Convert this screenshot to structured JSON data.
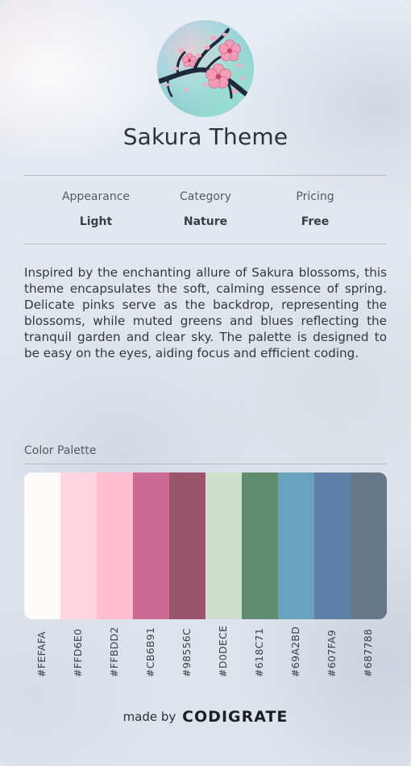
{
  "theme": {
    "title": "Sakura Theme",
    "logo_icon": "cherry-blossom-branch-icon"
  },
  "meta": [
    {
      "label": "Appearance",
      "value": "Light"
    },
    {
      "label": "Category",
      "value": "Nature"
    },
    {
      "label": "Pricing",
      "value": "Free"
    }
  ],
  "description": "Inspired by the enchanting allure of Sakura blossoms, this theme encapsulates the soft, calming essence of spring. Delicate pinks serve as the backdrop, representing the blossoms, while muted greens and blues reflecting the tranquil garden and clear sky. The palette is designed to be easy on the eyes, aiding focus and efficient coding.",
  "palette": {
    "title": "Color Palette",
    "colors": [
      "#FEFAFA",
      "#FFD6E0",
      "#FFBDD2",
      "#CB6B91",
      "#98556C",
      "#D0DECE",
      "#618C71",
      "#69A2BD",
      "#607FA9",
      "#687788"
    ]
  },
  "footer": {
    "made_by": "made by",
    "brand": "CODIGRATE"
  }
}
